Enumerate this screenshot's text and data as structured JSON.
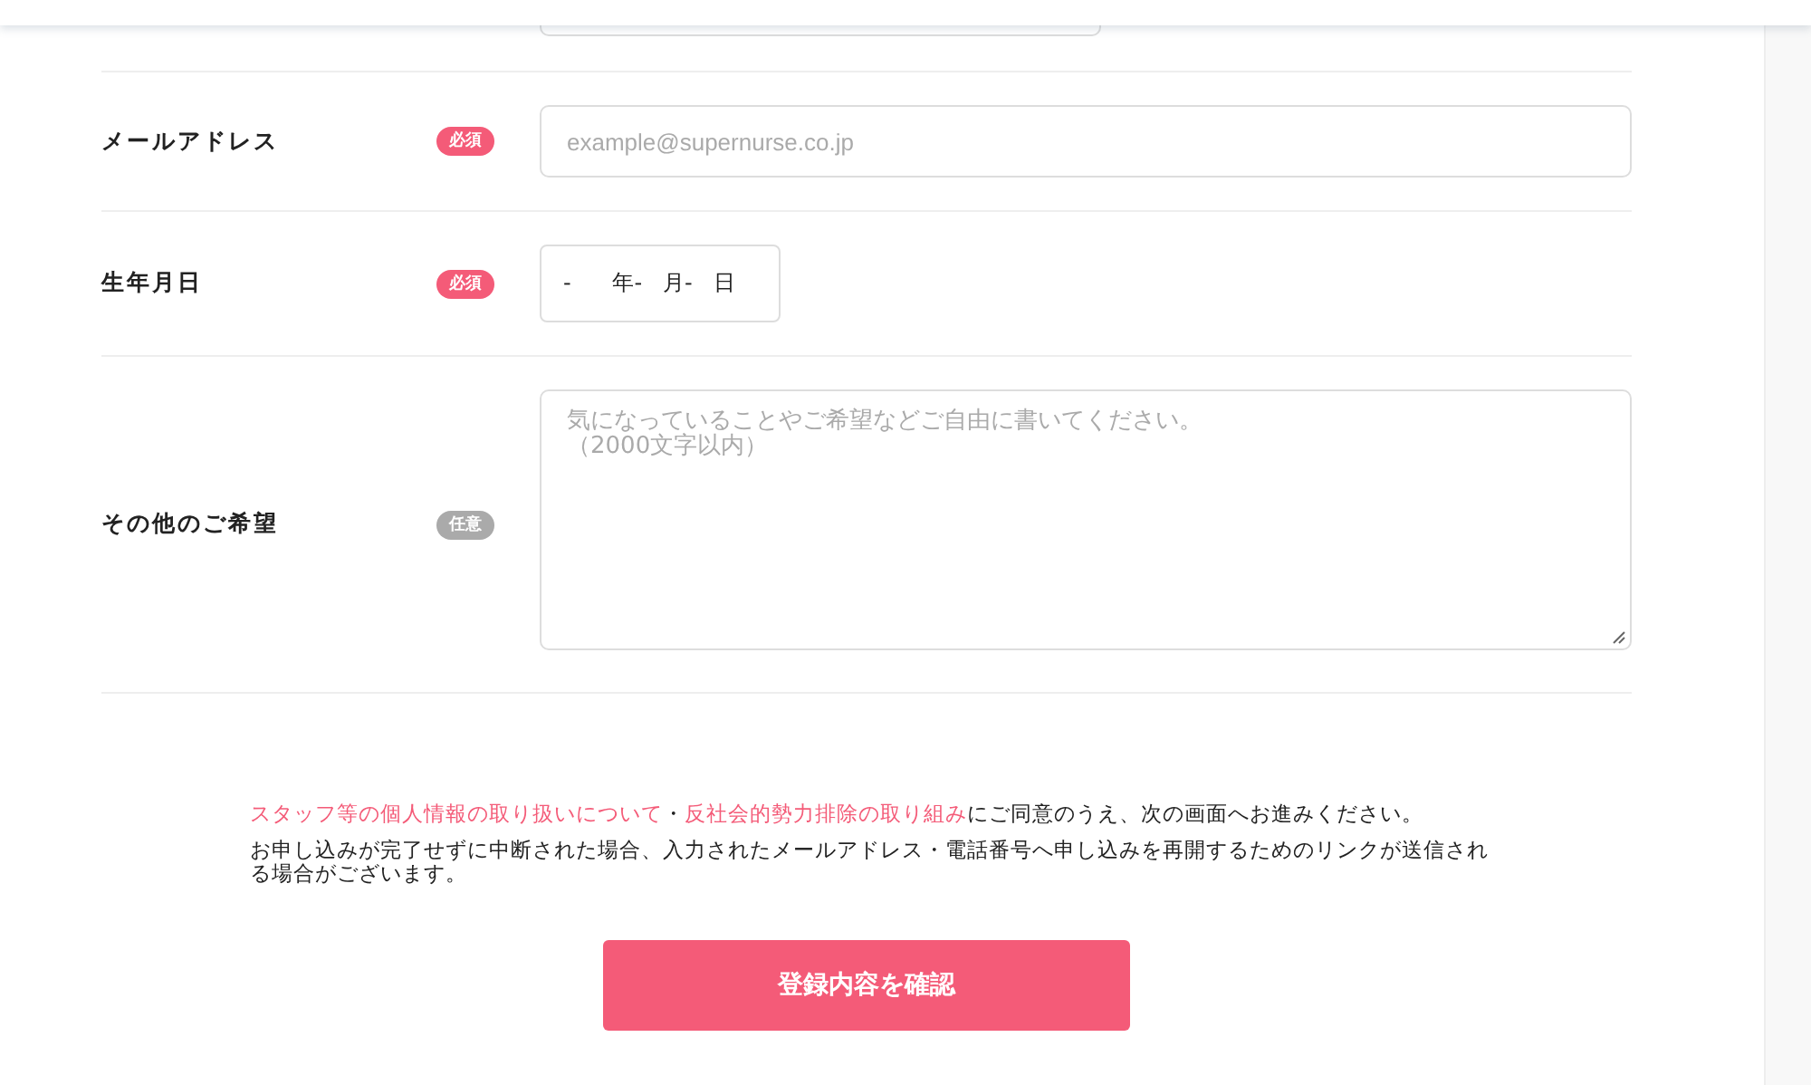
{
  "fields": [
    {
      "label": "メールアドレス",
      "badge": {
        "kind": "required",
        "text": "必須"
      },
      "kind": "text",
      "placeholder": "example@supernurse.co.jp"
    },
    {
      "label": "生年月日",
      "badge": {
        "kind": "required",
        "text": "必須"
      },
      "kind": "date",
      "value": "-      年-   月-   日"
    },
    {
      "label": "その他のご希望",
      "badge": {
        "kind": "optional",
        "text": "任意"
      },
      "kind": "textarea",
      "placeholder": [
        "気になっていることやご希望などご自由に書いてください。",
        "（2000文字以内）"
      ]
    }
  ],
  "consent": {
    "links": [
      "スタッフ等の個人情報の取り扱いについて",
      "反社会的勢力排除の取り組み"
    ],
    "separator": "・",
    "text": "にご同意のうえ、次の画面へお進みください。"
  },
  "note": "お申し込みが完了せずに中断された場合、入力されたメールアドレス・電話番号へ申し込みを再開するためのリンクが送信される場合がございます。",
  "submit_button": "登録内容を確認"
}
